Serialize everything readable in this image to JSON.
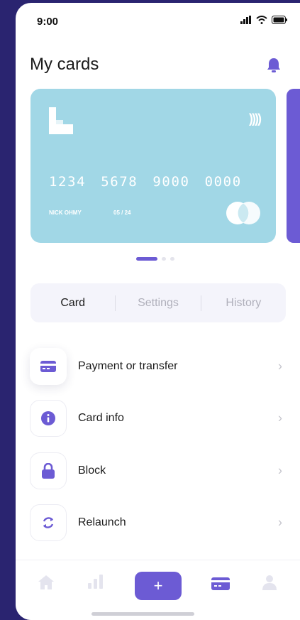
{
  "status": {
    "time": "9:00"
  },
  "header": {
    "title": "My cards"
  },
  "card": {
    "number": "1234 5678 9000 0000",
    "holder": "NICK OHMY",
    "expiry": "05 / 24",
    "nfc_symbol": "))))"
  },
  "pager": {
    "count": 3,
    "active_index": 0
  },
  "tabs": [
    {
      "label": "Card",
      "active": true
    },
    {
      "label": "Settings",
      "active": false
    },
    {
      "label": "History",
      "active": false
    }
  ],
  "menu": [
    {
      "label": "Payment or transfer",
      "icon": "card-icon"
    },
    {
      "label": "Card info",
      "icon": "info-icon"
    },
    {
      "label": "Block",
      "icon": "lock-icon"
    },
    {
      "label": "Relaunch",
      "icon": "relaunch-icon"
    }
  ],
  "bottom_nav": {
    "add_symbol": "+",
    "active": "cards",
    "items": [
      "home-icon",
      "stats-icon",
      "add-button",
      "cards-icon",
      "profile-icon"
    ]
  },
  "colors": {
    "accent": "#6c5bd4",
    "card": "#a1d7e6",
    "background": "#2a2470",
    "inactive": "#e4e4ee"
  }
}
